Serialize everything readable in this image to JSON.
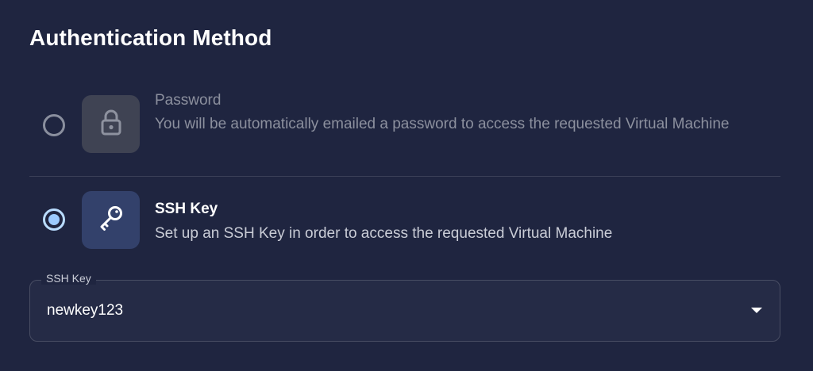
{
  "section": {
    "title": "Authentication Method"
  },
  "options": [
    {
      "title": "Password",
      "description": "You will be automatically emailed a password to access the requested Virtual Machine",
      "icon": "lock-icon",
      "selected": false
    },
    {
      "title": "SSH Key",
      "description": "Set up an SSH Key in order to access the requested Virtual Machine",
      "icon": "key-icon",
      "selected": true
    }
  ],
  "ssh_key_field": {
    "label": "SSH Key",
    "value": "newkey123"
  },
  "colors": {
    "background": "#1f2540",
    "radio_selected": "#9ccaff",
    "text_primary": "#ffffff",
    "text_muted": "#8c909e"
  }
}
